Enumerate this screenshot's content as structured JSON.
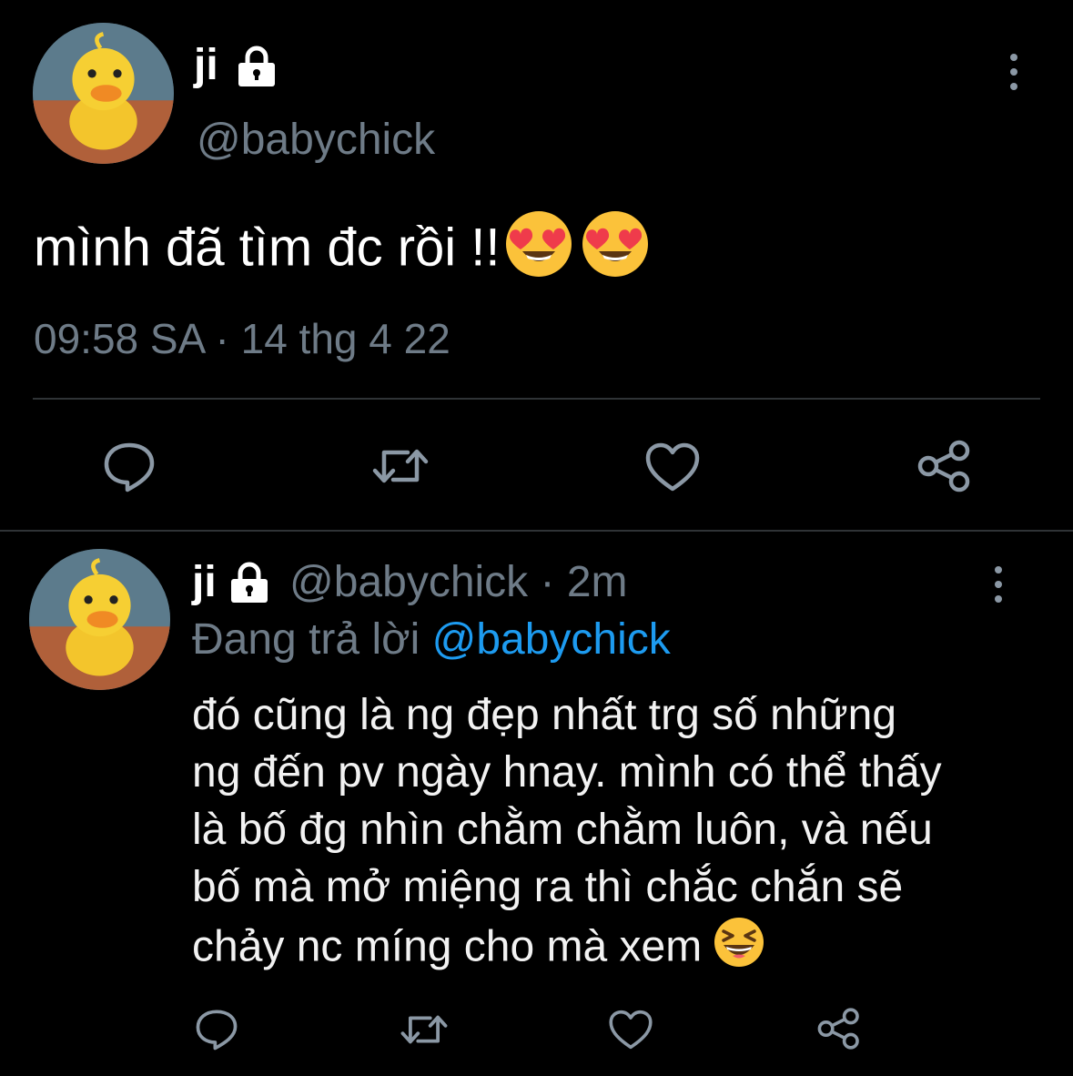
{
  "main_tweet": {
    "display_name": "ji",
    "handle": "@babychick",
    "text": "mình đã tìm đc rồi !!",
    "emojis": [
      "heart-eyes-emoji",
      "heart-eyes-emoji"
    ],
    "time": "09:58 SA",
    "separator": "·",
    "date": "14 thg 4 22"
  },
  "reply_tweet": {
    "display_name": "ji",
    "handle": "@babychick",
    "separator": "·",
    "age": "2m",
    "replying_prefix": "Đang trả lời",
    "replying_to": "@babychick",
    "text_lines": [
      "đó cũng là ng đẹp nhất trg số những",
      "ng đến pv ngày hnay. mình có thể thấy",
      "là bố đg nhìn chằm chằm luôn, và nếu",
      "bố mà mở miệng ra thì chắc chắn sẽ",
      "chảy nc míng cho mà xem"
    ],
    "trailing_emoji": "laughing-emoji"
  },
  "actions": [
    "reply-icon",
    "retweet-icon",
    "like-icon",
    "share-icon"
  ],
  "colors": {
    "background": "#000000",
    "text": "#ffffff",
    "secondary": "#6e7b87",
    "link": "#1d9bf0",
    "divider": "#2f3336"
  }
}
